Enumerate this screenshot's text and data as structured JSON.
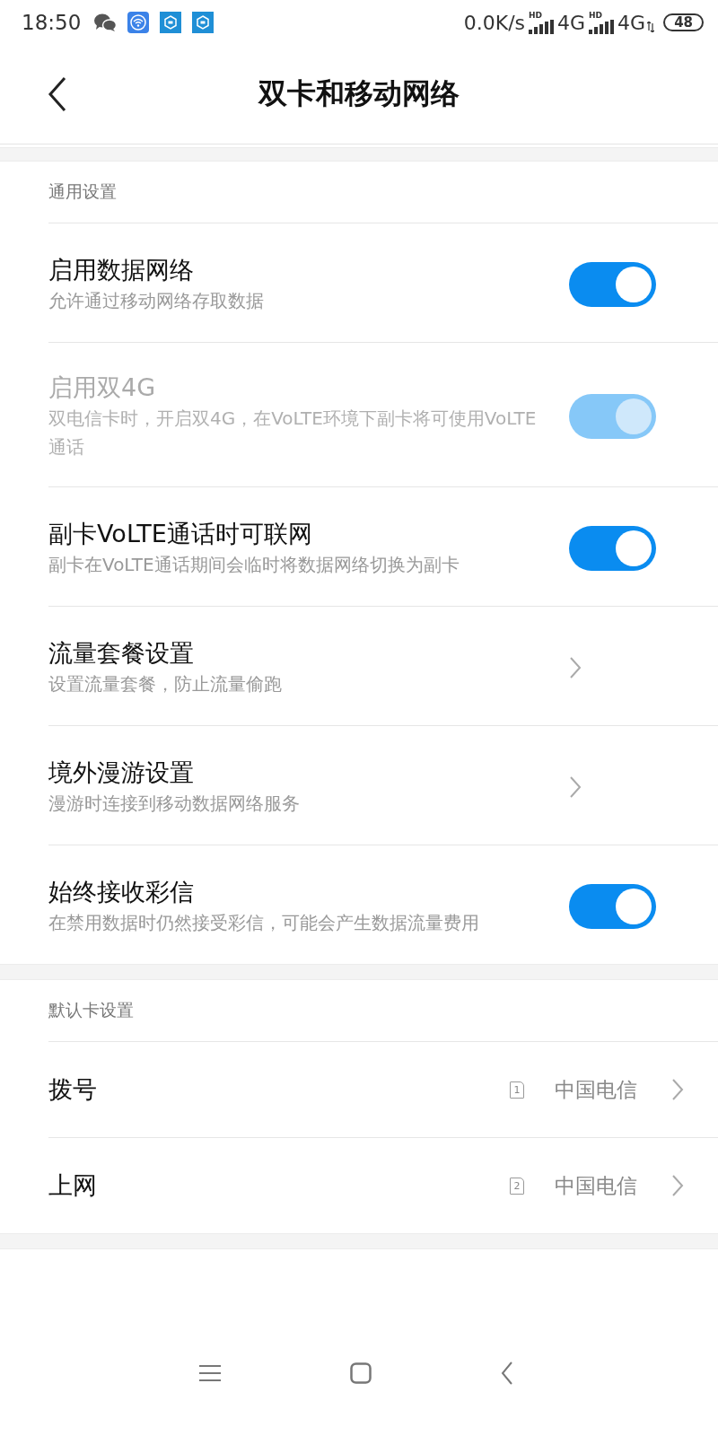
{
  "status_bar": {
    "time": "18:50",
    "speed": "0.0K/s",
    "sims": [
      {
        "hd": "HD",
        "network": "4G",
        "activity": false
      },
      {
        "hd": "HD",
        "network": "4G",
        "activity": true
      }
    ],
    "battery": "48"
  },
  "header": {
    "title": "双卡和移动网络"
  },
  "sections": [
    {
      "title": "通用设置",
      "items": [
        {
          "kind": "toggle",
          "title": "启用数据网络",
          "subtitle": "允许通过移动网络存取数据",
          "on": true,
          "disabled": false
        },
        {
          "kind": "toggle",
          "title": "启用双4G",
          "subtitle": "双电信卡时，开启双4G，在VoLTE环境下副卡将可使用VoLTE通话",
          "on": true,
          "disabled": true
        },
        {
          "kind": "toggle",
          "title": "副卡VoLTE通话时可联网",
          "subtitle": "副卡在VoLTE通话期间会临时将数据网络切换为副卡",
          "on": true,
          "disabled": false
        },
        {
          "kind": "link",
          "title": "流量套餐设置",
          "subtitle": "设置流量套餐，防止流量偷跑"
        },
        {
          "kind": "link",
          "title": "境外漫游设置",
          "subtitle": "漫游时连接到移动数据网络服务"
        },
        {
          "kind": "toggle",
          "title": "始终接收彩信",
          "subtitle": "在禁用数据时仍然接受彩信，可能会产生数据流量费用",
          "on": true,
          "disabled": false
        }
      ]
    },
    {
      "title": "默认卡设置",
      "items": [
        {
          "kind": "sim",
          "title": "拨号",
          "slot": "1",
          "carrier": "中国电信"
        },
        {
          "kind": "sim",
          "title": "上网",
          "slot": "2",
          "carrier": "中国电信"
        }
      ]
    }
  ]
}
